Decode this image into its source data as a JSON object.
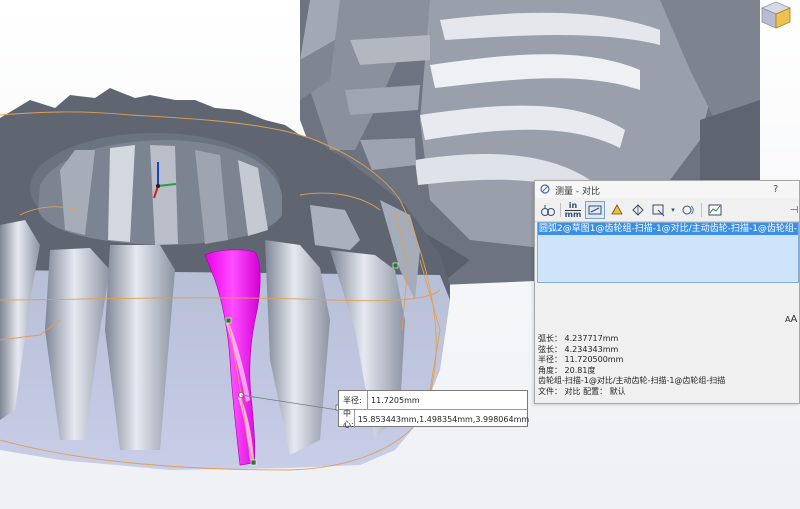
{
  "measure_dialog": {
    "title": "测量 - 对比",
    "help": "?",
    "toolbar": {
      "units_top": "in",
      "units_bottom": "mm"
    },
    "selection_item": "圆弧2@草图1@齿轮组-扫描-1@对比/主动齿轮-扫描-1@齿轮组-1",
    "results": {
      "arc_length": "弧长：  4.237717mm",
      "chord_length": "弦长：  4.234343mm",
      "radius": "半径：  11.720500mm",
      "angle": "角度：  20.81度",
      "path": "齿轮组-扫描-1@对比/主动齿轮-扫描-1@齿轮组-扫描",
      "file": "文件：  对比  配置：  默认"
    },
    "aa_label": "A",
    "aa_sub": "A"
  },
  "callout": {
    "radius_label": "半径:",
    "radius_value": "11.7205mm",
    "center_label": "中心:",
    "center_value": "15.853443mm,1.498354mm,3.998064mm"
  },
  "colors": {
    "highlight_face": "#ff00ff",
    "selection_bg": "#cde4fa",
    "selection_item_bg": "#3a8ee6",
    "model_gray": "#9aa0ad",
    "edge_orange": "#e0a050"
  }
}
